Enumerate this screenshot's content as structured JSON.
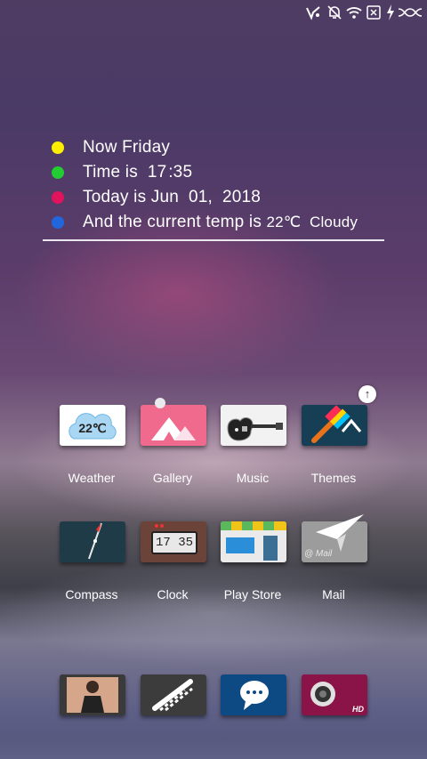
{
  "status_bar": {
    "icons": [
      "app-notification-icon",
      "mute-icon",
      "wifi-icon",
      "sim-card-x-icon",
      "charging-icon",
      "dna-icon"
    ],
    "sim_glyph": "✕"
  },
  "widget": {
    "lines": [
      {
        "prefix": "Now Friday",
        "color": "#ffee00"
      },
      {
        "prefix": "Time is  17 :35",
        "color": "#22cc33"
      },
      {
        "prefix": "Today is Jun  01,  2018",
        "color": "#e0135c"
      },
      {
        "prefix": "And the current temp is ",
        "value": "22℃  Cloudy",
        "color": "#2266dd"
      }
    ]
  },
  "apps": [
    {
      "label": "Weather",
      "icon": "weather-cloud-icon",
      "icon_text": "22℃"
    },
    {
      "label": "Gallery",
      "icon": "gallery-mountain-icon"
    },
    {
      "label": "Music",
      "icon": "guitar-icon"
    },
    {
      "label": "Themes",
      "icon": "paint-brush-icon"
    },
    {
      "label": "Compass",
      "icon": "compass-needle-icon"
    },
    {
      "label": "Clock",
      "icon": "clock-icon",
      "icon_text": "17 35"
    },
    {
      "label": "Play Store",
      "icon": "store-icon"
    },
    {
      "label": "Mail",
      "icon": "paper-plane-icon",
      "icon_text": "@ Mail"
    }
  ],
  "dock": [
    {
      "icon": "contacts-photo-icon"
    },
    {
      "icon": "dialer-icon"
    },
    {
      "icon": "messages-bubble-icon"
    },
    {
      "icon": "camera-icon",
      "icon_text": "HD"
    }
  ],
  "colors": {
    "divider": "#e9e6ee",
    "accent_white": "#ffffff"
  }
}
